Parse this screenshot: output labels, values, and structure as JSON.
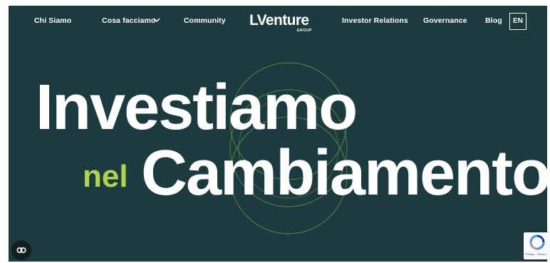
{
  "nav": {
    "items": [
      {
        "label": "Chi Siamo"
      },
      {
        "label": "Cosa facciamo"
      },
      {
        "label": "Community"
      },
      {
        "label": "Investor Relations"
      },
      {
        "label": "Governance"
      },
      {
        "label": "Blog"
      }
    ],
    "language": "EN"
  },
  "logo": {
    "name": "LVenture",
    "sub": "GROUP"
  },
  "hero": {
    "line1": "Investiamo",
    "line2_accent": "nel",
    "line2_main": "Cambiamento"
  },
  "recaptcha": {
    "footer": "Privacy - Termini"
  },
  "colors": {
    "background": "#1c3b3f",
    "accent": "#b3d14f",
    "text": "#ffffff"
  },
  "icons": {
    "cookie": "cookie-settings-icon",
    "chevron": "chevron-down-icon",
    "recaptcha": "recaptcha-icon"
  }
}
